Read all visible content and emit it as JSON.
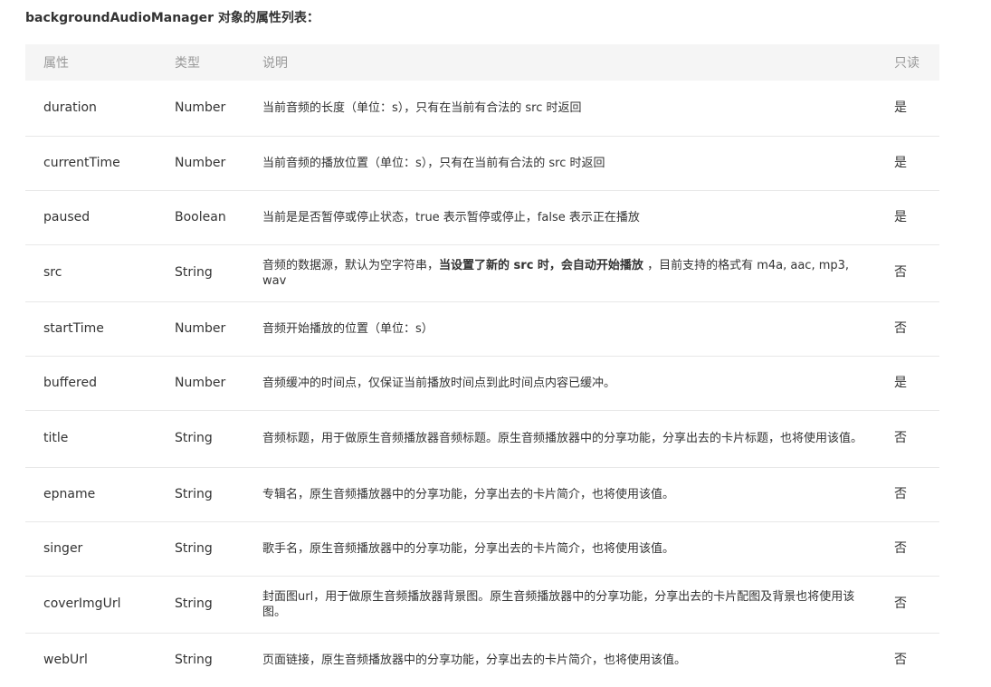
{
  "heading": "backgroundAudioManager 对象的属性列表：",
  "table": {
    "headers": [
      "属性",
      "类型",
      "说明",
      "只读"
    ],
    "rows": [
      {
        "name": "duration",
        "type": "Number",
        "desc_before": "当前音频的长度（单位：s），只有在当前有合法的 src 时返回",
        "desc_bold": "",
        "desc_after": "",
        "readonly": "是",
        "height": 61
      },
      {
        "name": "currentTime",
        "type": "Number",
        "desc_before": "当前音频的播放位置（单位：s），只有在当前有合法的 src 时返回",
        "desc_bold": "",
        "desc_after": "",
        "readonly": "是",
        "height": 60
      },
      {
        "name": "paused",
        "type": "Boolean",
        "desc_before": "当前是是否暂停或停止状态，true 表示暂停或停止，false 表示正在播放",
        "desc_bold": "",
        "desc_after": "",
        "readonly": "是",
        "height": 60
      },
      {
        "name": "src",
        "type": "String",
        "desc_before": "音频的数据源，默认为空字符串，",
        "desc_bold": "当设置了新的 src 时，会自动开始播放",
        "desc_after": " ，目前支持的格式有 m4a, aac, mp3, wav",
        "readonly": "否",
        "height": 63
      },
      {
        "name": "startTime",
        "type": "Number",
        "desc_before": "音频开始播放的位置（单位：s）",
        "desc_bold": "",
        "desc_after": "",
        "readonly": "否",
        "height": 60
      },
      {
        "name": "buffered",
        "type": "Number",
        "desc_before": "音频缓冲的时间点，仅保证当前播放时间点到此时间点内容已缓冲。",
        "desc_bold": "",
        "desc_after": "",
        "readonly": "是",
        "height": 60
      },
      {
        "name": "title",
        "type": "String",
        "desc_before": "音频标题，用于做原生音频播放器音频标题。原生音频播放器中的分享功能，分享出去的卡片标题，也将使用该值。",
        "desc_bold": "",
        "desc_after": "",
        "readonly": "否",
        "height": 63
      },
      {
        "name": "epname",
        "type": "String",
        "desc_before": "专辑名，原生音频播放器中的分享功能，分享出去的卡片简介，也将使用该值。",
        "desc_bold": "",
        "desc_after": "",
        "readonly": "否",
        "height": 60
      },
      {
        "name": "singer",
        "type": "String",
        "desc_before": "歌手名，原生音频播放器中的分享功能，分享出去的卡片简介，也将使用该值。",
        "desc_bold": "",
        "desc_after": "",
        "readonly": "否",
        "height": 60
      },
      {
        "name": "coverImgUrl",
        "type": "String",
        "desc_before": "封面图url，用于做原生音频播放器背景图。原生音频播放器中的分享功能，分享出去的卡片配图及背景也将使用该图。",
        "desc_bold": "",
        "desc_after": "",
        "readonly": "否",
        "height": 63
      },
      {
        "name": "webUrl",
        "type": "String",
        "desc_before": "页面链接，原生音频播放器中的分享功能，分享出去的卡片简介，也将使用该值。",
        "desc_bold": "",
        "desc_after": "",
        "readonly": "否",
        "height": 60
      }
    ]
  }
}
